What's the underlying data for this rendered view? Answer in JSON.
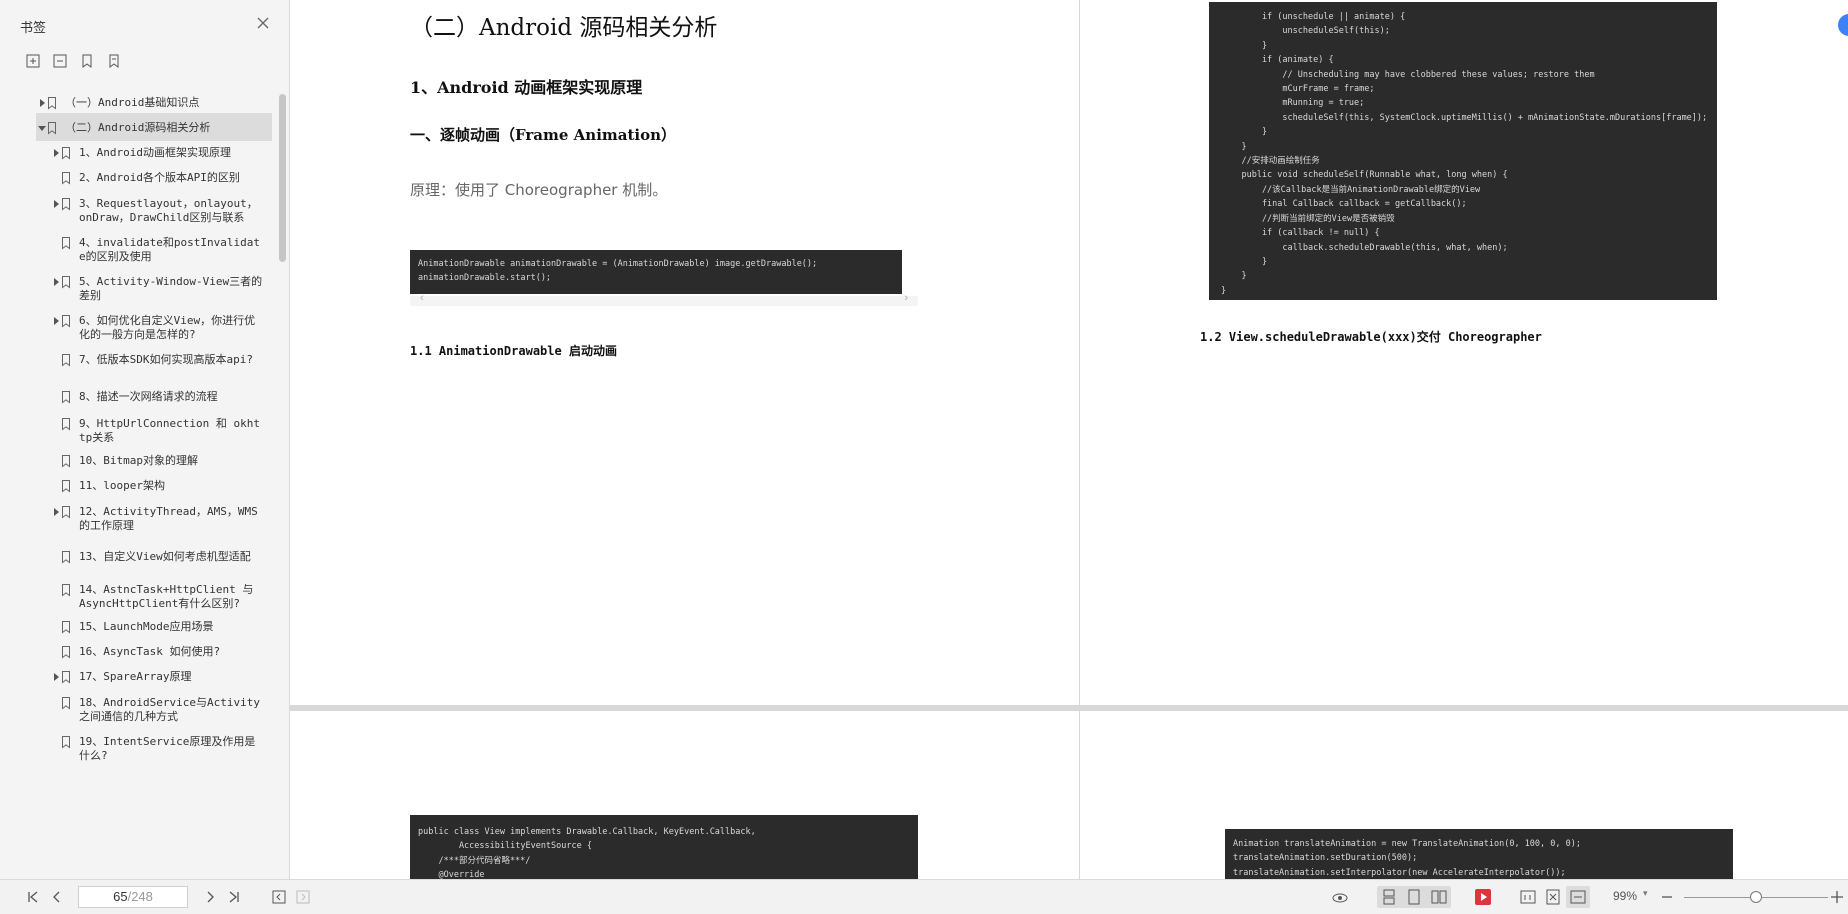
{
  "sidebar": {
    "title": "书签",
    "tools": [
      "expand-all-icon",
      "collapse-all-icon",
      "add-bookmark-icon",
      "bookmark-outline-icon"
    ],
    "items": [
      {
        "label": "（一）Android基础知识点",
        "level": 0,
        "expandable": true,
        "expanded": false
      },
      {
        "label": "（二）Android源码相关分析",
        "level": 0,
        "expandable": true,
        "expanded": true,
        "selected": true
      },
      {
        "label": "1、Android动画框架实现原理",
        "level": 1,
        "expandable": true
      },
      {
        "label": "2、Android各个版本API的区别",
        "level": 1,
        "expandable": false
      },
      {
        "label": "3、Requestlayout，onlayout，onDraw，DrawChild区别与联系",
        "level": 1,
        "expandable": true
      },
      {
        "label": "4、invalidate和postInvalidate的区别及使用",
        "level": 1,
        "expandable": false
      },
      {
        "label": "5、Activity-Window-View三者的差别",
        "level": 1,
        "expandable": true
      },
      {
        "label": "6、如何优化自定义View，你进行优化的一般方向是怎样的?",
        "level": 1,
        "expandable": true
      },
      {
        "label": "7、低版本SDK如何实现高版本api?",
        "level": 1,
        "expandable": false
      },
      {
        "label": "8、描述一次网络请求的流程",
        "level": 1,
        "expandable": false
      },
      {
        "label": "9、HttpUrlConnection 和 okhttp关系",
        "level": 1,
        "expandable": false
      },
      {
        "label": "10、Bitmap对象的理解",
        "level": 1,
        "expandable": false
      },
      {
        "label": "11、looper架构",
        "level": 1,
        "expandable": false
      },
      {
        "label": "12、ActivityThread，AMS，WMS的工作原理",
        "level": 1,
        "expandable": true
      },
      {
        "label": "13、自定义View如何考虑机型适配",
        "level": 1,
        "expandable": false
      },
      {
        "label": "14、AstncTask+HttpClient 与 AsyncHttpClient有什么区别?",
        "level": 1,
        "expandable": false
      },
      {
        "label": "15、LaunchMode应用场景",
        "level": 1,
        "expandable": false
      },
      {
        "label": "16、AsyncTask 如何使用?",
        "level": 1,
        "expandable": false
      },
      {
        "label": "17、SpareArray原理",
        "level": 1,
        "expandable": true
      },
      {
        "label": "18、AndroidService与Activity之间通信的几种方式",
        "level": 1,
        "expandable": false
      },
      {
        "label": "19、IntentService原理及作用是什么?",
        "level": 1,
        "expandable": false
      }
    ]
  },
  "document": {
    "page_left": {
      "h1": "（二）Android 源码相关分析",
      "h2": "1、Android 动画框架实现原理",
      "h3": "一、逐帧动画（Frame Animation）",
      "para": "原理：使用了 Choreographer 机制。",
      "code": "AnimationDrawable animationDrawable = (AnimationDrawable) image.getDrawable();\nanimationDrawable.start();",
      "h4": "1.1 AnimationDrawable 启动动画"
    },
    "page_right": {
      "code": "        if (unschedule || animate) {\n            unscheduleSelf(this);\n        }\n        if (animate) {\n            // Unscheduling may have clobbered these values; restore them\n            mCurFrame = frame;\n            mRunning = true;\n            scheduleSelf(this, SystemClock.uptimeMillis() + mAnimationState.mDurations[frame]);\n        }\n    }\n    //安排动画绘制任务\n    public void scheduleSelf(Runnable what, long when) {\n        //该Callback是当前AnimationDrawable绑定的View\n        final Callback callback = getCallback();\n        //判断当前绑定的View是否被销毁\n        if (callback != null) {\n            callback.scheduleDrawable(this, what, when);\n        }\n    }\n}",
      "h4": "1.2 View.scheduleDrawable(xxx)交付 Choreographer"
    },
    "page_bottom_left": {
      "code": "public class View implements Drawable.Callback, KeyEvent.Callback,\n        AccessibilityEventSource {\n    /***部分代码省略***/\n    @Override"
    },
    "page_bottom_right": {
      "code": "Animation translateAnimation = new TranslateAnimation(0, 100, 0, 0);\ntranslateAnimation.setDuration(500);\ntranslateAnimation.setInterpolator(new AccelerateInterpolator());"
    }
  },
  "statusbar": {
    "current_page": "65",
    "total_pages": "/248",
    "zoom": "99%",
    "zoom_fraction": 0.5,
    "icons": [
      "first-page-icon",
      "prev-page-icon",
      "next-page-icon",
      "last-page-icon",
      "back-icon",
      "forward-icon",
      "eye-icon",
      "continuous-view-icon",
      "single-page-icon",
      "two-page-icon",
      "play-icon",
      "actual-size-icon",
      "fit-page-icon",
      "fit-width-icon",
      "zoom-out-icon",
      "zoom-in-icon"
    ]
  }
}
